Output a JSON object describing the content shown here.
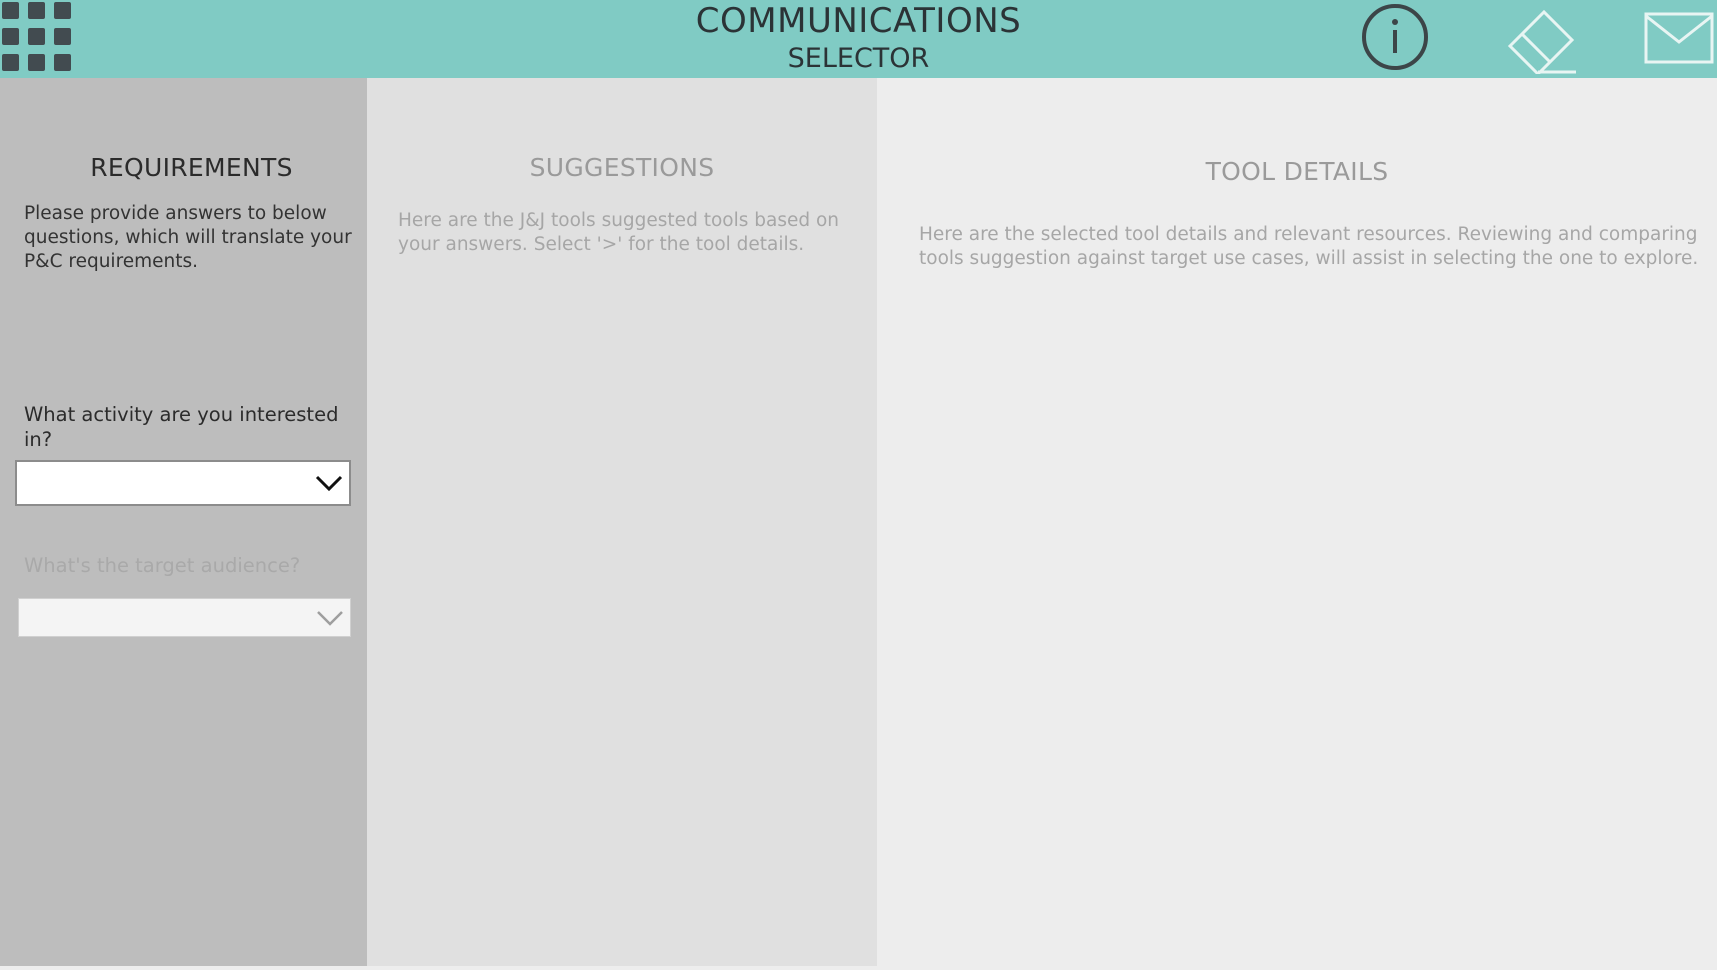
{
  "header": {
    "title": "COMMUNICATIONS",
    "subtitle": "SELECTOR",
    "icons": [
      "apps-grid-icon",
      "info-icon",
      "eraser-icon",
      "mail-icon"
    ],
    "background_color": "#80cbc4"
  },
  "requirements": {
    "title": "REQUIREMENTS",
    "description": "Please provide answers to below questions, which will translate your P&C requirements.",
    "questions": [
      {
        "label": "What activity are you interested in?",
        "value": "",
        "enabled": true
      },
      {
        "label": "What's the target audience?",
        "value": "",
        "enabled": false
      }
    ]
  },
  "suggestions": {
    "title": "SUGGESTIONS",
    "description": "Here are the J&J tools suggested tools based on your answers. Select '>' for the tool details."
  },
  "tool_details": {
    "title": "TOOL DETAILS",
    "description": "Here are the selected tool details and relevant resources. Reviewing and comparing tools suggestion against target use cases, will assist in selecting the one to explore."
  }
}
